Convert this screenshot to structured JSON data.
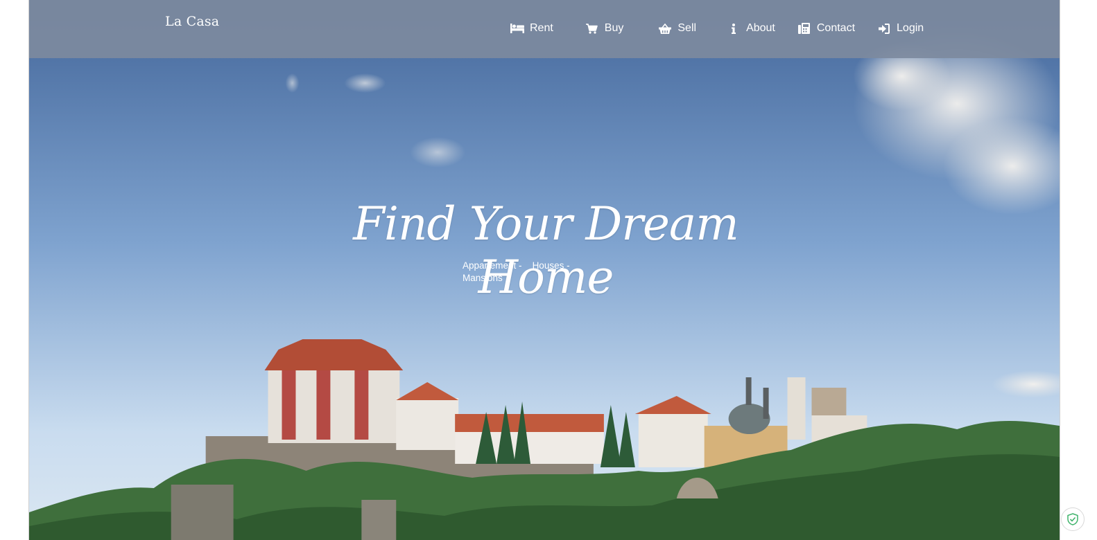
{
  "brand": "La Casa",
  "nav": {
    "rent": "Rent",
    "buy": "Buy",
    "sell": "Sell",
    "about": "About",
    "contact": "Contact",
    "login": "Login"
  },
  "icons": {
    "rent": "bed-icon",
    "buy": "cart-icon",
    "sell": "basket-icon",
    "about": "info-icon",
    "contact": "fax-icon",
    "login": "sign-in-icon",
    "extension": "shield-check-icon"
  },
  "hero": {
    "headline": "Find Your Dream Home",
    "sub1": "Appartement  -",
    "sub2": "Houses  -",
    "sub3": "Mansions"
  },
  "colors": {
    "navbar": "#7d8a9e",
    "sky_top": "#4a6d9c",
    "sky_bottom": "#d6e4f2",
    "roof": "#b24d36",
    "shield": "#3fb36b"
  }
}
